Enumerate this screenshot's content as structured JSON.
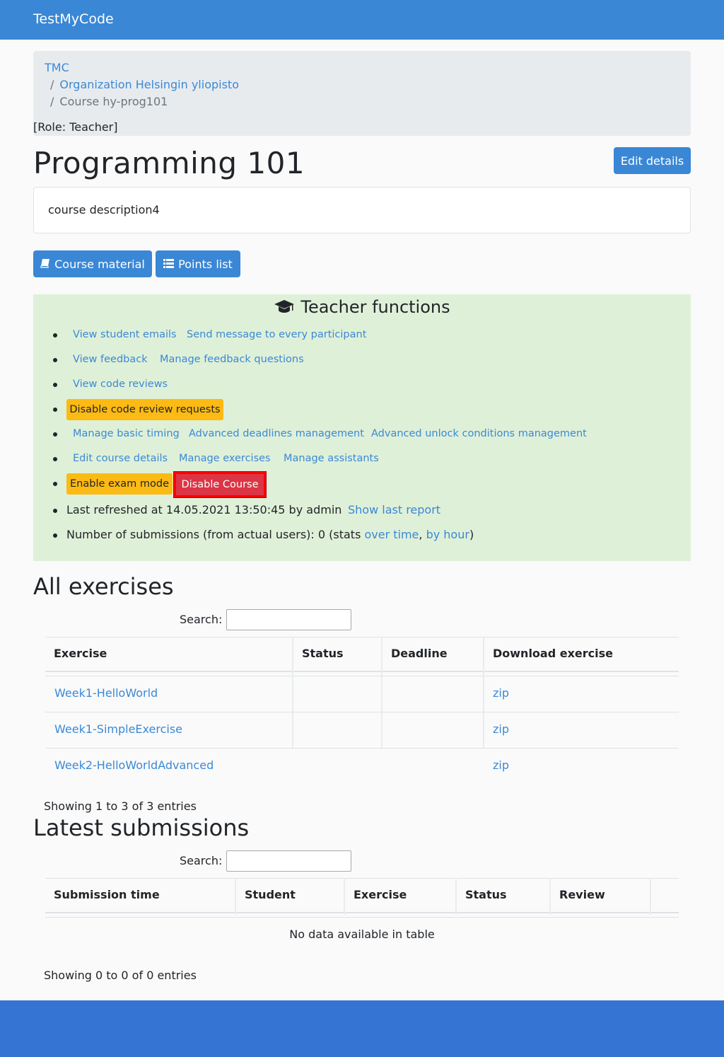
{
  "navbar": {
    "brand": "TestMyCode"
  },
  "breadcrumb": {
    "items": [
      "TMC",
      "Organization Helsingin yliopisto",
      "Course hy-prog101"
    ],
    "separator": "/",
    "role": "[Role: Teacher]"
  },
  "course": {
    "title": "Programming 101",
    "edit_label": "Edit details",
    "description": "course description4",
    "material_label": "Course material",
    "points_label": "Points list"
  },
  "teacher": {
    "heading": "Teacher functions",
    "view_emails": "View student emails",
    "send_message": "Send message to every participant",
    "view_feedback": "View feedback",
    "manage_feedback": "Manage feedback questions",
    "view_reviews": "View code reviews",
    "disable_reviews": "Disable code review requests",
    "manage_timing": "Manage basic timing",
    "adv_deadlines": "Advanced deadlines management",
    "adv_unlock": "Advanced unlock conditions management",
    "edit_course": "Edit course details",
    "manage_exercises": "Manage exercises",
    "manage_assistants": "Manage assistants",
    "exam_mode": "Enable exam mode",
    "disable_course": "Disable Course",
    "refreshed": "Last refreshed at 14.05.2021 13:50:45 by admin",
    "show_report": "Show last report",
    "submissions_prefix": "Number of submissions (from actual users): 0 (stats ",
    "over_time": "over time",
    "comma": ", ",
    "by_hour": "by hour",
    "close_paren": ")"
  },
  "exercises": {
    "heading": "All exercises",
    "search_label": "Search:",
    "columns": [
      "Exercise",
      "Status",
      "Deadline",
      "Download exercise"
    ],
    "rows": [
      {
        "name": "Week1-HelloWorld",
        "status": "",
        "deadline": "",
        "download": "zip"
      },
      {
        "name": "Week1-SimpleExercise",
        "status": "",
        "deadline": "",
        "download": "zip"
      },
      {
        "name": "Week2-HelloWorldAdvanced",
        "status": "",
        "deadline": "",
        "download": "zip"
      }
    ],
    "info": "Showing 1 to 3 of 3 entries"
  },
  "submissions": {
    "heading": "Latest submissions",
    "search_label": "Search:",
    "columns": [
      "Submission time",
      "Student",
      "Exercise",
      "Status",
      "Review"
    ],
    "empty": "No data available in table",
    "info": "Showing 0 to 0 of 0 entries"
  },
  "colors": {
    "primary": "#3a87d6",
    "warning": "#fcba14",
    "danger": "#dc3545",
    "success_bg": "#dff0d8",
    "footer": "#3674d4"
  }
}
